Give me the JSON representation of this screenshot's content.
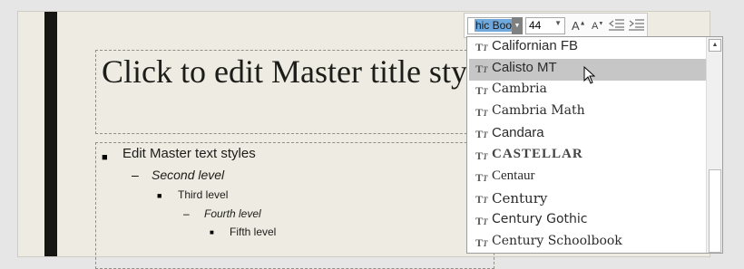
{
  "slide": {
    "title": "Click to edit Master title styles",
    "levels": [
      {
        "bullet": "■",
        "text": "Edit Master text styles"
      },
      {
        "bullet": "–",
        "text": "Second level"
      },
      {
        "bullet": "■",
        "text": "Third level"
      },
      {
        "bullet": "–",
        "text": "Fourth level"
      },
      {
        "bullet": "■",
        "text": "Fifth level"
      }
    ]
  },
  "toolbar": {
    "font_name_value": "hic Book",
    "font_size_value": "44",
    "grow_font_label": "A",
    "shrink_font_label": "A"
  },
  "font_list": {
    "items": [
      {
        "icon": "truetype-icon",
        "label": "Californian FB"
      },
      {
        "icon": "truetype-icon",
        "label": "Calisto MT",
        "selected": true
      },
      {
        "icon": "truetype-icon",
        "label": "Cambria"
      },
      {
        "icon": "truetype-icon",
        "label": "Cambria Math"
      },
      {
        "icon": "truetype-icon",
        "label": "Candara"
      },
      {
        "icon": "truetype-icon",
        "label": "CASTELLAR"
      },
      {
        "icon": "truetype-icon",
        "label": "Centaur"
      },
      {
        "icon": "truetype-icon",
        "label": "Century"
      },
      {
        "icon": "truetype-icon",
        "label": "Century Gothic"
      },
      {
        "icon": "truetype-icon",
        "label": "Century Schoolbook"
      }
    ]
  },
  "colors": {
    "slide_bg": "#eeebe2",
    "accent_bar": "#161612",
    "selection_highlight": "#6fa8dc",
    "hover_row": "#c6c6c6"
  }
}
